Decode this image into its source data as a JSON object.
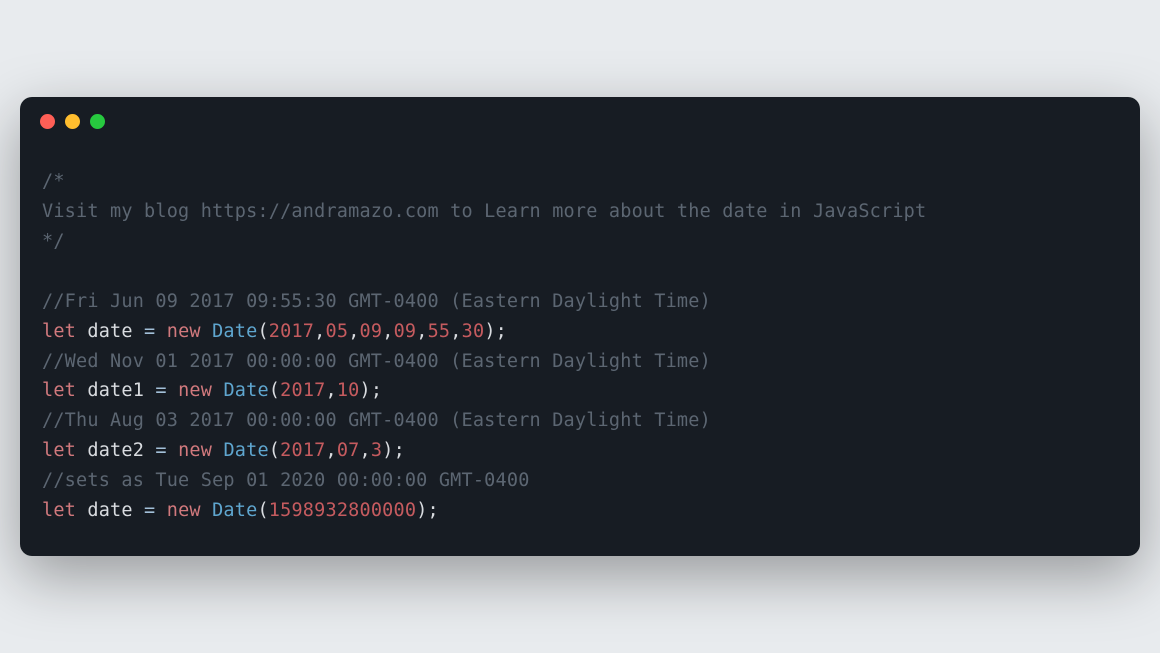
{
  "colors": {
    "close": "#ff5f56",
    "minimize": "#ffbd2e",
    "zoom": "#27c93f",
    "comment": "#5c6672",
    "keyword": "#d1797d",
    "classname": "#5fa6cf",
    "operator": "#a3c0d9",
    "number": "#c55b5f",
    "text": "#d9dce0",
    "background": "#171c23"
  },
  "code": {
    "block_comment": {
      "open": "/*",
      "body": "Visit my blog https://andramazo.com to Learn more about the date in JavaScript",
      "close": "*/"
    },
    "lines": [
      {
        "type": "comment",
        "text": "//Fri Jun 09 2017 09:55:30 GMT-0400 (Eastern Daylight Time)"
      },
      {
        "type": "stmt",
        "kw1": "let",
        "ident": "date",
        "eq": " = ",
        "kw2": "new",
        "cls": "Date",
        "args": [
          "2017",
          "05",
          "09",
          "09",
          "55",
          "30"
        ]
      },
      {
        "type": "comment",
        "text": "//Wed Nov 01 2017 00:00:00 GMT-0400 (Eastern Daylight Time)"
      },
      {
        "type": "stmt",
        "kw1": "let",
        "ident": "date1",
        "eq": " = ",
        "kw2": "new",
        "cls": "Date",
        "args": [
          "2017",
          "10"
        ]
      },
      {
        "type": "comment",
        "text": "//Thu Aug 03 2017 00:00:00 GMT-0400 (Eastern Daylight Time)"
      },
      {
        "type": "stmt",
        "kw1": "let",
        "ident": "date2",
        "eq": " = ",
        "kw2": "new",
        "cls": "Date",
        "args": [
          "2017",
          "07",
          "3"
        ]
      },
      {
        "type": "comment",
        "text": "//sets as Tue Sep 01 2020 00:00:00 GMT-0400"
      },
      {
        "type": "stmt",
        "kw1": "let",
        "ident": "date",
        "eq": " = ",
        "kw2": "new",
        "cls": "Date",
        "args": [
          "1598932800000"
        ]
      }
    ]
  }
}
